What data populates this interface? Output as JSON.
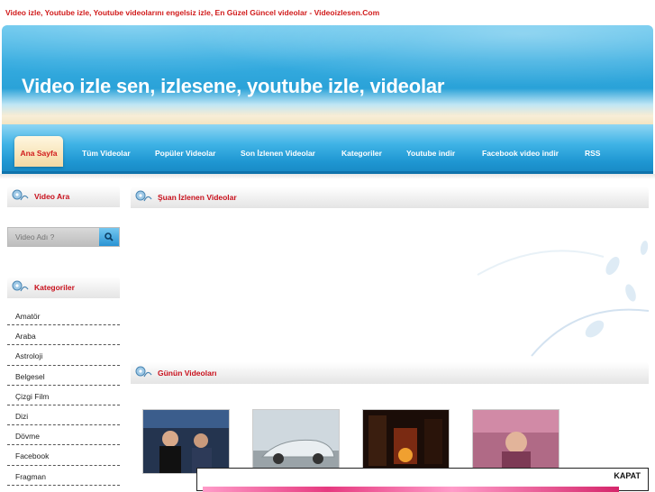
{
  "browser_title": "Video izle, Youtube izle, Youtube videolarını engelsiz izle, En Güzel Güncel videolar - Videoizlesen.Com",
  "header": {
    "title": "Video izle sen, izlesene, youtube izle, videolar"
  },
  "nav": {
    "home": "Ana Sayfa",
    "items": [
      "Tüm Videolar",
      "Popüler Videolar",
      "Son İzlenen Videolar",
      "Kategoriler",
      "Youtube indir",
      "Facebook video indir",
      "RSS"
    ]
  },
  "sidebar": {
    "search_title": "Video Ara",
    "search_placeholder": "Video Adı ?",
    "categories_title": "Kategoriler",
    "categories": [
      "Amatör",
      "Araba",
      "Astroloji",
      "Belgesel",
      "Çizgi Film",
      "Dizi",
      "Dövme",
      "Facebook",
      "Fragman"
    ]
  },
  "main": {
    "now_watching_title": "Şuan İzlenen Videolar",
    "today_title": "Günün Videoları"
  },
  "overlay": {
    "close_label": "KAPAT"
  },
  "colors": {
    "accent_red": "#c8101c",
    "header_blue": "#2aa2d8",
    "nav_blue": "#1f97d2"
  }
}
